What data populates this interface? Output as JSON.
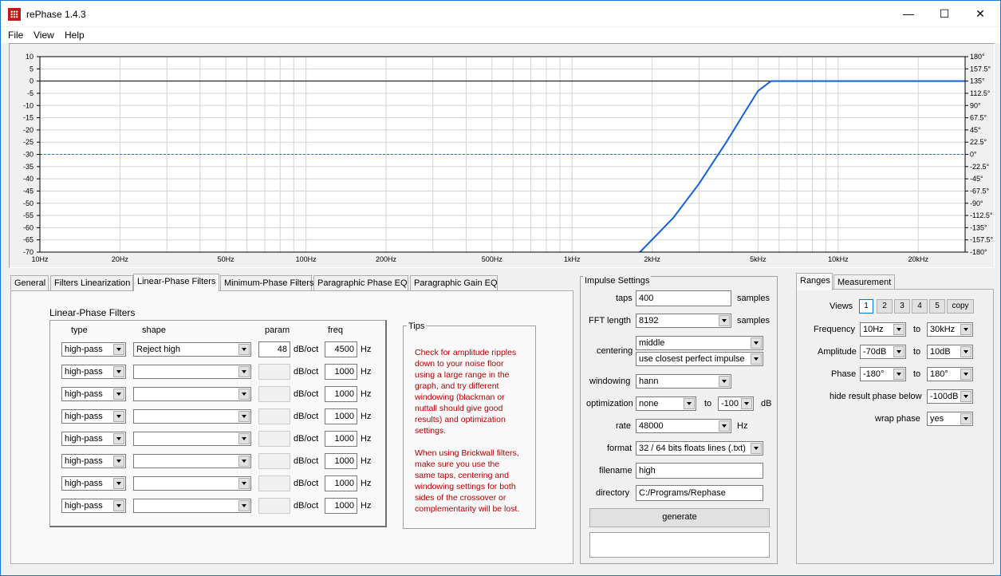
{
  "window": {
    "title": "rePhase 1.4.3",
    "minimize": "—",
    "maximize": "☐",
    "close": "✕"
  },
  "menu": [
    "File",
    "View",
    "Help"
  ],
  "graph": {
    "left_ticks": [
      "10",
      "5",
      "0",
      "-5",
      "-10",
      "-15",
      "-20",
      "-25",
      "-30",
      "-35",
      "-40",
      "-45",
      "-50",
      "-55",
      "-60",
      "-65",
      "-70"
    ],
    "right_ticks": [
      "180°",
      "157.5°",
      "135°",
      "112.5°",
      "90°",
      "67.5°",
      "45°",
      "22.5°",
      "0°",
      "-22.5°",
      "-45°",
      "-67.5°",
      "-90°",
      "-112.5°",
      "-135°",
      "-157.5°",
      "-180°"
    ],
    "freq_labels": [
      {
        "f": 10,
        "label": "10Hz"
      },
      {
        "f": 20,
        "label": "20Hz"
      },
      {
        "f": 50,
        "label": "50Hz"
      },
      {
        "f": 100,
        "label": "100Hz"
      },
      {
        "f": 200,
        "label": "200Hz"
      },
      {
        "f": 500,
        "label": "500Hz"
      },
      {
        "f": 1000,
        "label": "1kHz"
      },
      {
        "f": 2000,
        "label": "2kHz"
      },
      {
        "f": 5000,
        "label": "5kHz"
      },
      {
        "f": 10000,
        "label": "10kHz"
      },
      {
        "f": 20000,
        "label": "20kHz"
      }
    ],
    "x_range_hz": [
      10,
      30000
    ],
    "amplitude_range_db": [
      -70,
      10
    ],
    "phase_range_deg": [
      -180,
      180
    ],
    "amplitude_curve": [
      [
        10,
        -150
      ],
      [
        1800,
        -70
      ],
      [
        2400,
        -56
      ],
      [
        3000,
        -42
      ],
      [
        3800,
        -25
      ],
      [
        4500,
        -12
      ],
      [
        5000,
        -4
      ],
      [
        5600,
        0
      ],
      [
        30000,
        0
      ]
    ],
    "phase_curve": [
      [
        10,
        0
      ],
      [
        30000,
        0
      ]
    ],
    "grid": true,
    "colors": {
      "amplitude": "#1560d8",
      "phase": "#2a6fd6",
      "zero_line": "#000000",
      "grid": "#d3d3d3"
    }
  },
  "tabs_left": [
    {
      "label": "General"
    },
    {
      "label": "Filters Linearization"
    },
    {
      "label": "Linear-Phase Filters",
      "active": true
    },
    {
      "label": "Minimum-Phase Filters"
    },
    {
      "label": "Paragraphic Phase EQ"
    },
    {
      "label": "Paragraphic Gain EQ"
    }
  ],
  "linear_phase": {
    "title": "Linear-Phase Filters",
    "headers": {
      "type": "type",
      "shape": "shape",
      "param": "param",
      "freq": "freq"
    },
    "param_unit": "dB/oct",
    "freq_unit": "Hz",
    "rows": [
      {
        "type": "high-pass",
        "shape": "Reject high",
        "param": "48",
        "freq": "4500"
      },
      {
        "type": "high-pass",
        "shape": "",
        "param": "",
        "freq": "1000"
      },
      {
        "type": "high-pass",
        "shape": "",
        "param": "",
        "freq": "1000"
      },
      {
        "type": "high-pass",
        "shape": "",
        "param": "",
        "freq": "1000"
      },
      {
        "type": "high-pass",
        "shape": "",
        "param": "",
        "freq": "1000"
      },
      {
        "type": "high-pass",
        "shape": "",
        "param": "",
        "freq": "1000"
      },
      {
        "type": "high-pass",
        "shape": "",
        "param": "",
        "freq": "1000"
      },
      {
        "type": "high-pass",
        "shape": "",
        "param": "",
        "freq": "1000"
      }
    ]
  },
  "tips": {
    "title": "Tips",
    "p1": [
      "Check for amplitude ripples",
      "down to your noise floor",
      "using a large range in the",
      "graph, and try different",
      "windowing (blackman or",
      "nuttall should give good",
      "results) and optimization",
      "settings."
    ],
    "p2": [
      "When using Brickwall filters,",
      "make sure you use the",
      "same taps, centering and",
      "windowing settings for both",
      "sides of the crossover or",
      "complementarity will be lost."
    ]
  },
  "impulse": {
    "title": "Impulse Settings",
    "taps_label": "taps",
    "taps": "400",
    "taps_unit": "samples",
    "fft_label": "FFT length",
    "fft": "8192",
    "fft_unit": "samples",
    "centering_label": "centering",
    "centering": "middle",
    "centering2": "use closest perfect impulse",
    "windowing_label": "windowing",
    "windowing": "hann",
    "optimization_label": "optimization",
    "optimization": "none",
    "opt_to": "to",
    "opt_db": "-100",
    "opt_unit": "dB",
    "rate_label": "rate",
    "rate": "48000",
    "rate_unit": "Hz",
    "format_label": "format",
    "format": "32 / 64 bits floats lines (.txt)",
    "filename_label": "filename",
    "filename": "high",
    "directory_label": "directory",
    "directory": "C:/Programs/Rephase",
    "generate": "generate"
  },
  "tabs_right": [
    {
      "label": "Ranges",
      "active": true
    },
    {
      "label": "Measurement"
    }
  ],
  "ranges": {
    "views_label": "Views",
    "views": [
      "1",
      "2",
      "3",
      "4",
      "5"
    ],
    "copy": "copy",
    "frequency_label": "Frequency",
    "freq_from": "10Hz",
    "freq_to": "30kHz",
    "amplitude_label": "Amplitude",
    "amp_from": "-70dB",
    "amp_to": "10dB",
    "phase_label": "Phase",
    "phase_from": "-180°",
    "phase_to": "180°",
    "to": "to",
    "hide_label": "hide result phase below",
    "hide": "-100dB",
    "wrap_label": "wrap phase",
    "wrap": "yes"
  }
}
